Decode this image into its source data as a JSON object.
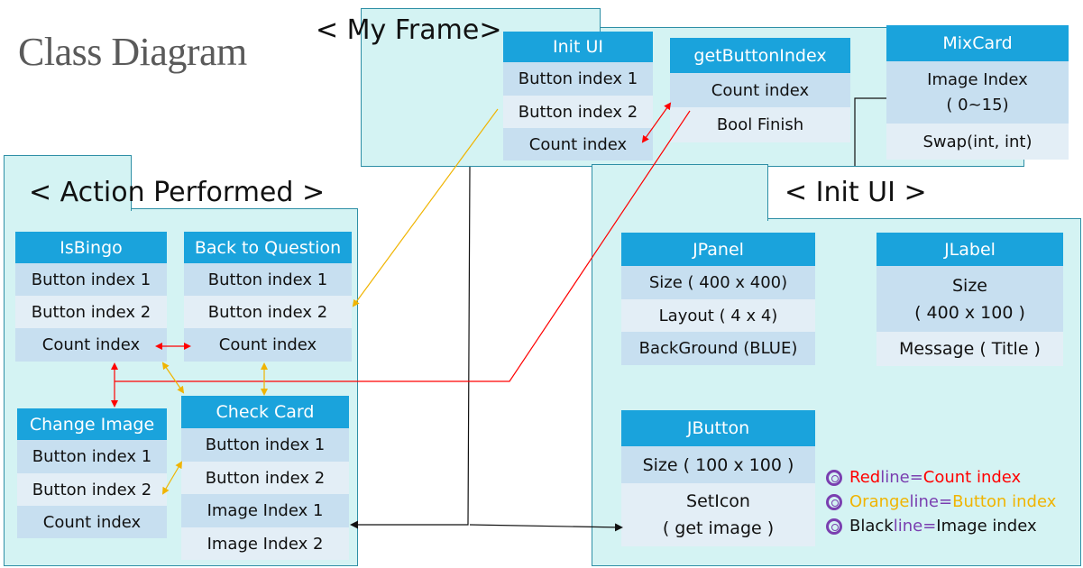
{
  "title": "Class Diagram",
  "frames": {
    "my_frame": "< My Frame>",
    "action_performed": "< Action Performed >",
    "init_ui": "< Init UI >"
  },
  "boxes": {
    "init_ui": {
      "header": "Init UI",
      "rows": [
        "Button index 1",
        "Button index 2",
        "Count index"
      ]
    },
    "get_button_index": {
      "header": "getButtonIndex",
      "rows": [
        "Count index",
        "Bool Finish"
      ]
    },
    "mix_card": {
      "header": "MixCard",
      "rows": [
        "Image Index\n( 0~15)",
        "Swap(int, int)"
      ]
    },
    "is_bingo": {
      "header": "IsBingo",
      "rows": [
        "Button index 1",
        "Button index 2",
        "Count index"
      ]
    },
    "back_to_question": {
      "header": "Back to Question",
      "rows": [
        "Button index 1",
        "Button index 2",
        "Count index"
      ]
    },
    "change_image": {
      "header": "Change Image",
      "rows": [
        "Button index 1",
        "Button index 2",
        "Count index"
      ]
    },
    "check_card": {
      "header": "Check Card",
      "rows": [
        "Button index 1",
        "Button index 2",
        "Image Index 1",
        "Image Index 2"
      ]
    },
    "jpanel": {
      "header": "JPanel",
      "rows": [
        "Size ( 400 x 400)",
        "Layout ( 4 x 4)",
        "BackGround (BLUE)"
      ]
    },
    "jlabel": {
      "header": "JLabel",
      "rows": [
        "Size\n( 400 x 100 )",
        "Message ( Title )"
      ]
    },
    "jbutton": {
      "header": "JButton",
      "rows": [
        "Size ( 100 x 100 )",
        "SetIcon\n( get image )"
      ]
    }
  },
  "legend": [
    {
      "prefix": "Red",
      "word": " line",
      "eq": " = ",
      "rest": "Count index",
      "color": "#ff0000"
    },
    {
      "prefix": "Orange",
      "word": " line",
      "eq": " = ",
      "rest": "Button index",
      "color": "#f0b400"
    },
    {
      "prefix": "Black",
      "word": " line",
      "eq": " = ",
      "rest": "Image index",
      "color": "#111111"
    }
  ],
  "colors": {
    "red_line": "#ff0000",
    "orange_line": "#f0b400",
    "black_line": "#111111",
    "frame_fill": "#d4f3f3",
    "header_fill": "#1aa3dc",
    "legend_word": "#7a3fb0"
  }
}
